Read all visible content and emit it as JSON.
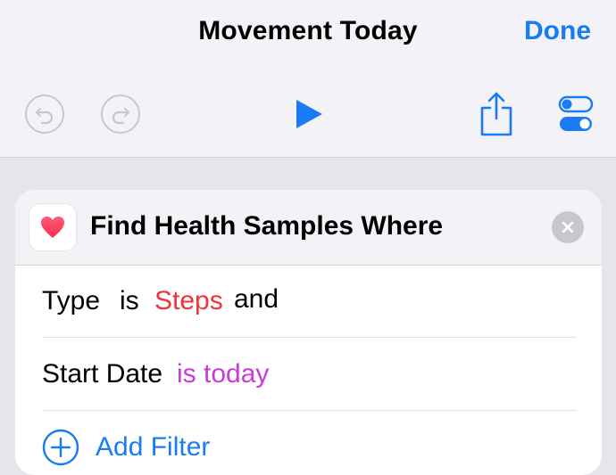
{
  "header": {
    "title": "Movement Today",
    "done_label": "Done"
  },
  "toolbar": {
    "undo_icon": "undo-icon",
    "redo_icon": "redo-icon",
    "play_icon": "play-icon",
    "share_icon": "share-icon",
    "settings_icon": "toggles-icon",
    "accent_color": "#1a7cf5"
  },
  "action": {
    "title": "Find Health Samples Where",
    "icon": "heart-icon",
    "filters": [
      {
        "field": "Type",
        "operator": "is",
        "value": "Steps",
        "conjunction": "and",
        "value_color": "#f2323a"
      },
      {
        "field": "Start Date",
        "operator_value": "is today",
        "value_color": "#c93ad6"
      }
    ],
    "add_filter_label": "Add Filter"
  }
}
